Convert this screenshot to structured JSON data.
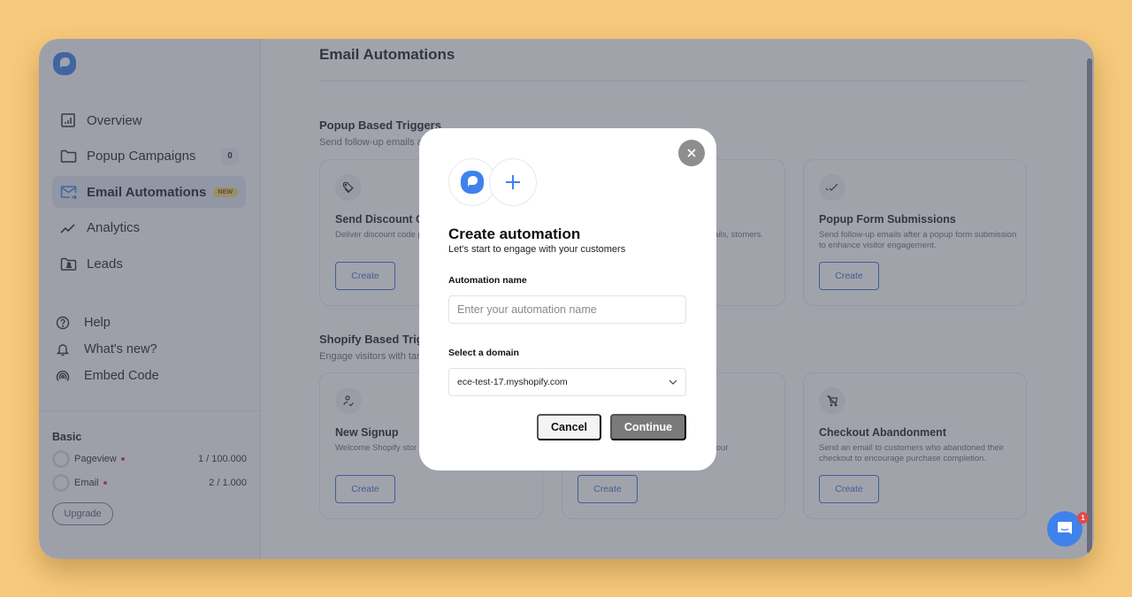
{
  "sidebar": {
    "nav": [
      {
        "label": "Overview",
        "icon": "chart-icon"
      },
      {
        "label": "Popup Campaigns",
        "icon": "folder-icon",
        "count": "0"
      },
      {
        "label": "Email Automations",
        "icon": "mail-icon",
        "badge": "NEW",
        "active": true
      },
      {
        "label": "Analytics",
        "icon": "trend-icon"
      },
      {
        "label": "Leads",
        "icon": "leads-folder-icon"
      }
    ],
    "secondary": [
      {
        "label": "Help",
        "icon": "help-icon"
      },
      {
        "label": "What's new?",
        "icon": "bell-icon"
      },
      {
        "label": "Embed Code",
        "icon": "broadcast-icon"
      }
    ],
    "plan": {
      "title": "Basic",
      "usage": [
        {
          "label": "Pageview",
          "value": "1 / 100.000"
        },
        {
          "label": "Email",
          "value": "2 / 1.000"
        }
      ],
      "upgrade_label": "Upgrade"
    }
  },
  "main": {
    "title": "Email Automations",
    "sections": [
      {
        "title": "Popup Based Triggers",
        "subtitle": "Send follow-up emails a",
        "cards": [
          {
            "title": "Send Discount C",
            "desc": "Deliver discount code popup form submissio",
            "button": "Create",
            "icon": "tag-icon"
          },
          {
            "title": "",
            "desc": "h emails, stomers.",
            "button": "Create",
            "icon": ""
          },
          {
            "title": "Popup Form Submissions",
            "desc": "Send follow-up emails after a popup form submission to enhance visitor engagement.",
            "button": "Create",
            "icon": "double-check-icon"
          }
        ]
      },
      {
        "title": "Shopify Based Trigg",
        "subtitle": "Engage visitors with tar",
        "cards": [
          {
            "title": "New Signup",
            "desc": "Welcome Shopify stor creating a personalize",
            "button": "Create",
            "icon": "user-check-icon"
          },
          {
            "title": "ase",
            "desc": "rom your",
            "button": "Create",
            "icon": ""
          },
          {
            "title": "Checkout Abandonment",
            "desc": "Send an email to customers who abandoned their checkout to encourage purchase completion.",
            "button": "Create",
            "icon": "cart-off-icon"
          }
        ]
      }
    ]
  },
  "modal": {
    "title": "Create automation",
    "subtitle": "Let's start to engage with your customers",
    "name_label": "Automation name",
    "name_value": "",
    "name_placeholder": "Enter your automation name",
    "domain_label": "Select a domain",
    "domain_value": "ece-test-17.myshopify.com",
    "cancel_label": "Cancel",
    "continue_label": "Continue"
  },
  "chat": {
    "unread": "1"
  },
  "colors": {
    "brand": "#3f82ec",
    "accent": "#3e73d6",
    "background": "#f6c97c"
  }
}
